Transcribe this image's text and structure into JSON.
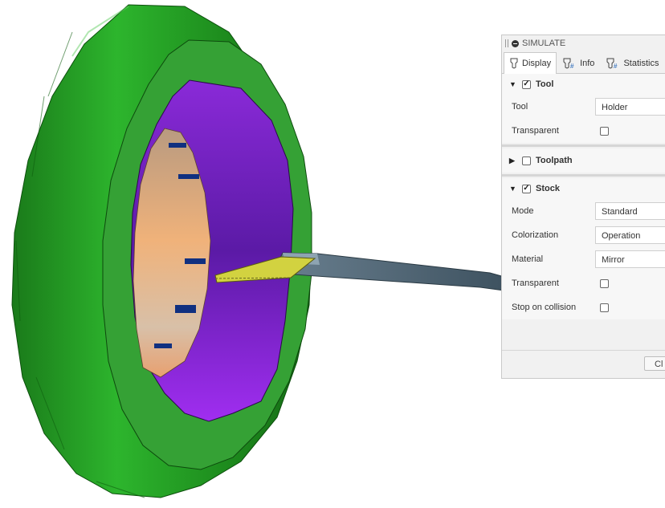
{
  "panel": {
    "title": "SIMULATE",
    "tabs": [
      {
        "label": "Display",
        "icon": "display-tool-icon",
        "active": true
      },
      {
        "label": "Info",
        "icon": "info-tool-icon",
        "active": false
      },
      {
        "label": "Statistics",
        "icon": "statistics-tool-icon",
        "active": false
      }
    ],
    "tool": {
      "header": "Tool",
      "checked": true,
      "tool_label": "Tool",
      "tool_value": "Holder",
      "transparent_label": "Transparent",
      "transparent_checked": false
    },
    "toolpath": {
      "header": "Toolpath",
      "checked": false
    },
    "stock": {
      "header": "Stock",
      "checked": true,
      "mode_label": "Mode",
      "mode_value": "Standard",
      "colorization_label": "Colorization",
      "colorization_value": "Operation",
      "material_label": "Material",
      "material_value": "Mirror",
      "transparent_label": "Transparent",
      "transparent_checked": false,
      "stop_label": "Stop on collision",
      "stop_checked": false
    },
    "close_label": "Cl"
  },
  "viewport": {
    "ring_color": "#2fa52f",
    "inner_color": "#8a1fd6",
    "tool_color": "#c8c832",
    "holder_color": "#4d6270"
  }
}
